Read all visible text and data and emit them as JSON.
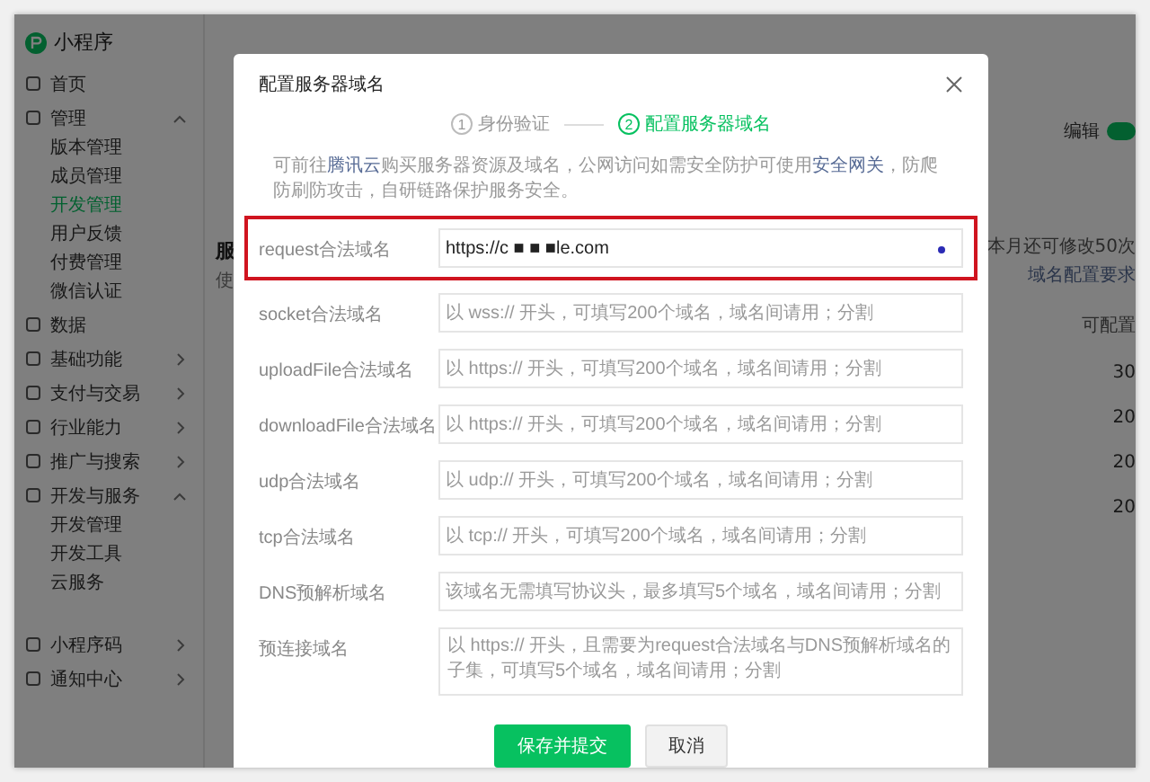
{
  "app": {
    "name": "小程序"
  },
  "sidebar": {
    "items": [
      {
        "label": "首页",
        "kind": "link"
      },
      {
        "label": "管理",
        "kind": "group",
        "expanded": true,
        "children": [
          {
            "label": "版本管理",
            "selected": false
          },
          {
            "label": "成员管理",
            "selected": false
          },
          {
            "label": "开发管理",
            "selected": true
          },
          {
            "label": "用户反馈",
            "selected": false
          },
          {
            "label": "付费管理",
            "selected": false
          },
          {
            "label": "微信认证",
            "selected": false
          }
        ]
      },
      {
        "label": "数据",
        "kind": "link"
      },
      {
        "label": "基础功能",
        "kind": "group",
        "expanded": false
      },
      {
        "label": "支付与交易",
        "kind": "group",
        "expanded": false
      },
      {
        "label": "行业能力",
        "kind": "group",
        "expanded": false
      },
      {
        "label": "推广与搜索",
        "kind": "group",
        "expanded": false
      },
      {
        "label": "开发与服务",
        "kind": "group",
        "expanded": true,
        "children": [
          {
            "label": "开发管理",
            "selected": false
          },
          {
            "label": "开发工具",
            "selected": false
          },
          {
            "label": "云服务",
            "selected": false
          }
        ]
      }
    ],
    "bottom_items": [
      {
        "label": "小程序码",
        "kind": "group",
        "expanded": false
      },
      {
        "label": "通知中心",
        "kind": "group",
        "expanded": false
      }
    ]
  },
  "page": {
    "title_fragment": "服",
    "subtitle_fragment": "使",
    "edit_label": "编辑",
    "switch_on": true,
    "quota_note": "本月还可修改50次",
    "requirements_link": "域名配置要求",
    "column_header": "可配置",
    "column_values": [
      "30",
      "20",
      "20",
      "20"
    ]
  },
  "dialog": {
    "title": "配置服务器域名",
    "steps": [
      {
        "number": "1",
        "label": "身份验证",
        "selected": false
      },
      {
        "number": "2",
        "label": "配置服务器域名",
        "selected": true
      }
    ],
    "description": [
      {
        "kind": "text",
        "text": "可前往"
      },
      {
        "kind": "link",
        "text": "腾讯云"
      },
      {
        "kind": "text",
        "text": "购买服务器资源及域名，公网访问如需安全防护可使用"
      },
      {
        "kind": "link",
        "text": "安全网关"
      },
      {
        "kind": "text",
        "text": "，防爬防刷防攻击，自研链路保护服务安全。"
      }
    ],
    "fields": [
      {
        "label": "request合法域名",
        "kind": "input",
        "value": "https://c ■ ■ ■le.com",
        "highlighted": true
      },
      {
        "label": "socket合法域名",
        "kind": "input",
        "placeholder": "以 wss:// 开头，可填写200个域名，域名间请用；分割",
        "highlighted": false
      },
      {
        "label": "uploadFile合法域名",
        "kind": "input",
        "placeholder": "以 https:// 开头，可填写200个域名，域名间请用；分割",
        "highlighted": false
      },
      {
        "label": "downloadFile合法域名",
        "kind": "input",
        "placeholder": "以 https:// 开头，可填写200个域名，域名间请用；分割",
        "highlighted": false
      },
      {
        "label": "udp合法域名",
        "kind": "input",
        "placeholder": "以 udp:// 开头，可填写200个域名，域名间请用；分割",
        "highlighted": false
      },
      {
        "label": "tcp合法域名",
        "kind": "input",
        "placeholder": "以 tcp:// 开头，可填写200个域名，域名间请用；分割",
        "highlighted": false
      },
      {
        "label": "DNS预解析域名",
        "kind": "input",
        "placeholder": "该域名无需填写协议头，最多填写5个域名，域名间请用；分割",
        "highlighted": false
      },
      {
        "label": "预连接域名",
        "kind": "textarea",
        "placeholder": "以 https:// 开头，且需要为request合法域名与DNS预解析域名的子集，可填写5个域名，域名间请用；分割",
        "highlighted": false
      }
    ],
    "buttons": [
      {
        "label": "保存并提交",
        "kind": "primary"
      },
      {
        "label": "取消",
        "kind": "secondary"
      }
    ]
  }
}
